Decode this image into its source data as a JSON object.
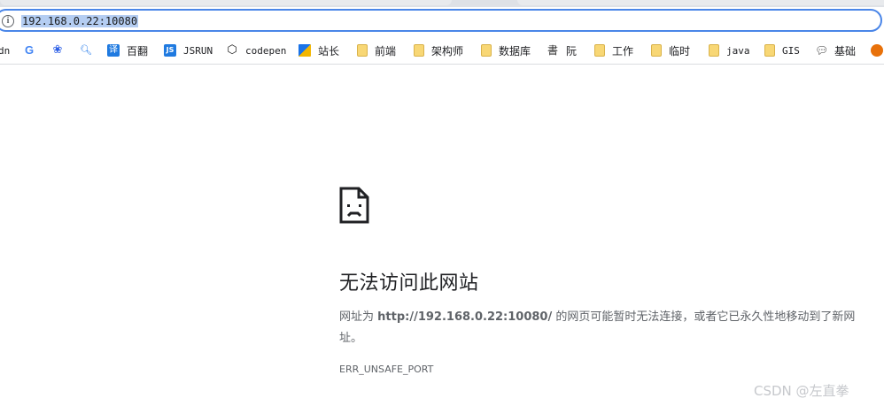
{
  "address_bar": {
    "url": "192.168.0.22:10080",
    "info_icon": "info-icon"
  },
  "bookmarks": [
    {
      "label": "dn",
      "icon": "none"
    },
    {
      "label": "",
      "icon": "google-icon"
    },
    {
      "label": "",
      "icon": "baidu-paw-icon"
    },
    {
      "label": "",
      "icon": "search-icon"
    },
    {
      "label": "百翻",
      "icon": "translate-icon"
    },
    {
      "label": "JSRUN",
      "icon": "jsrun-icon"
    },
    {
      "label": "codepen",
      "icon": "codepen-icon"
    },
    {
      "label": "站长",
      "icon": "zhanzhang-icon"
    },
    {
      "label": "前端",
      "icon": "folder-icon"
    },
    {
      "label": "架构师",
      "icon": "folder-icon"
    },
    {
      "label": "数据库",
      "icon": "folder-icon"
    },
    {
      "label": "阮",
      "icon": "ruan-icon"
    },
    {
      "label": "工作",
      "icon": "folder-icon"
    },
    {
      "label": "临时",
      "icon": "folder-icon"
    },
    {
      "label": "java",
      "icon": "folder-icon"
    },
    {
      "label": "GIS",
      "icon": "folder-icon"
    },
    {
      "label": "基础",
      "icon": "chat-bubble-icon"
    },
    {
      "label": "",
      "icon": "extension-icon"
    }
  ],
  "error_page": {
    "icon": "sad-page-icon",
    "title": "无法访问此网站",
    "desc_prefix": "网址为 ",
    "desc_url": "http://192.168.0.22:10080/",
    "desc_suffix": " 的网页可能暂时无法连接，或者它已永久性地移动到了新网址。",
    "error_code": "ERR_UNSAFE_PORT"
  },
  "watermark": "CSDN @左直拳",
  "colors": {
    "omnibox_border": "#4a86e8",
    "url_selection": "#b4cdf2",
    "folder": "#f8d775",
    "text_secondary": "#5f6368"
  }
}
